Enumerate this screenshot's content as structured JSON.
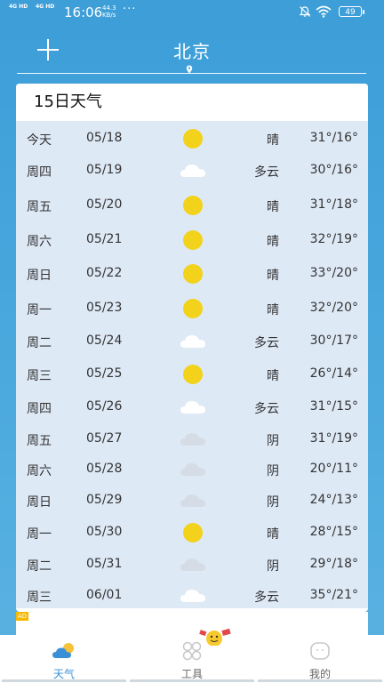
{
  "status_bar": {
    "net1": "4G HD",
    "net2": "4G HD",
    "time": "16:06",
    "speed_value": "44.3",
    "speed_unit": "KB/s",
    "dots": "···",
    "battery": "49"
  },
  "header": {
    "city": "北京"
  },
  "card": {
    "title": "15日天气",
    "rows": [
      {
        "day": "今天",
        "date": "05/18",
        "icon": "sun-icon",
        "cond": "晴",
        "temp": "31°/16°"
      },
      {
        "day": "周四",
        "date": "05/19",
        "icon": "cloud-icon",
        "cond": "多云",
        "temp": "30°/16°"
      },
      {
        "day": "周五",
        "date": "05/20",
        "icon": "sun-icon",
        "cond": "晴",
        "temp": "31°/18°"
      },
      {
        "day": "周六",
        "date": "05/21",
        "icon": "sun-icon",
        "cond": "晴",
        "temp": "32°/19°"
      },
      {
        "day": "周日",
        "date": "05/22",
        "icon": "sun-icon",
        "cond": "晴",
        "temp": "33°/20°"
      },
      {
        "day": "周一",
        "date": "05/23",
        "icon": "sun-icon",
        "cond": "晴",
        "temp": "32°/20°"
      },
      {
        "day": "周二",
        "date": "05/24",
        "icon": "cloud-icon",
        "cond": "多云",
        "temp": "30°/17°"
      },
      {
        "day": "周三",
        "date": "05/25",
        "icon": "sun-icon",
        "cond": "晴",
        "temp": "26°/14°"
      },
      {
        "day": "周四",
        "date": "05/26",
        "icon": "cloud-icon",
        "cond": "多云",
        "temp": "31°/15°"
      },
      {
        "day": "周五",
        "date": "05/27",
        "icon": "overcast-icon",
        "cond": "阴",
        "temp": "31°/19°"
      },
      {
        "day": "周六",
        "date": "05/28",
        "icon": "overcast-icon",
        "cond": "阴",
        "temp": "20°/11°"
      },
      {
        "day": "周日",
        "date": "05/29",
        "icon": "overcast-icon",
        "cond": "阴",
        "temp": "24°/13°"
      },
      {
        "day": "周一",
        "date": "05/30",
        "icon": "sun-icon",
        "cond": "晴",
        "temp": "28°/15°"
      },
      {
        "day": "周二",
        "date": "05/31",
        "icon": "overcast-icon",
        "cond": "阴",
        "temp": "29°/18°"
      },
      {
        "day": "周三",
        "date": "06/01",
        "icon": "cloud-icon",
        "cond": "多云",
        "temp": "35°/21°"
      }
    ]
  },
  "ad": {
    "tag": "AD"
  },
  "tabs": [
    {
      "label": "天气",
      "icon": "weather-icon",
      "active": true
    },
    {
      "label": "工具",
      "icon": "tools-icon",
      "active": false
    },
    {
      "label": "我的",
      "icon": "profile-icon",
      "active": false
    }
  ],
  "colors": {
    "sky": "#46a6dc",
    "sun": "#f2d21a",
    "cloud": "#ffffff",
    "overcast": "#dde3ec",
    "active_tab": "#3a90d6"
  }
}
